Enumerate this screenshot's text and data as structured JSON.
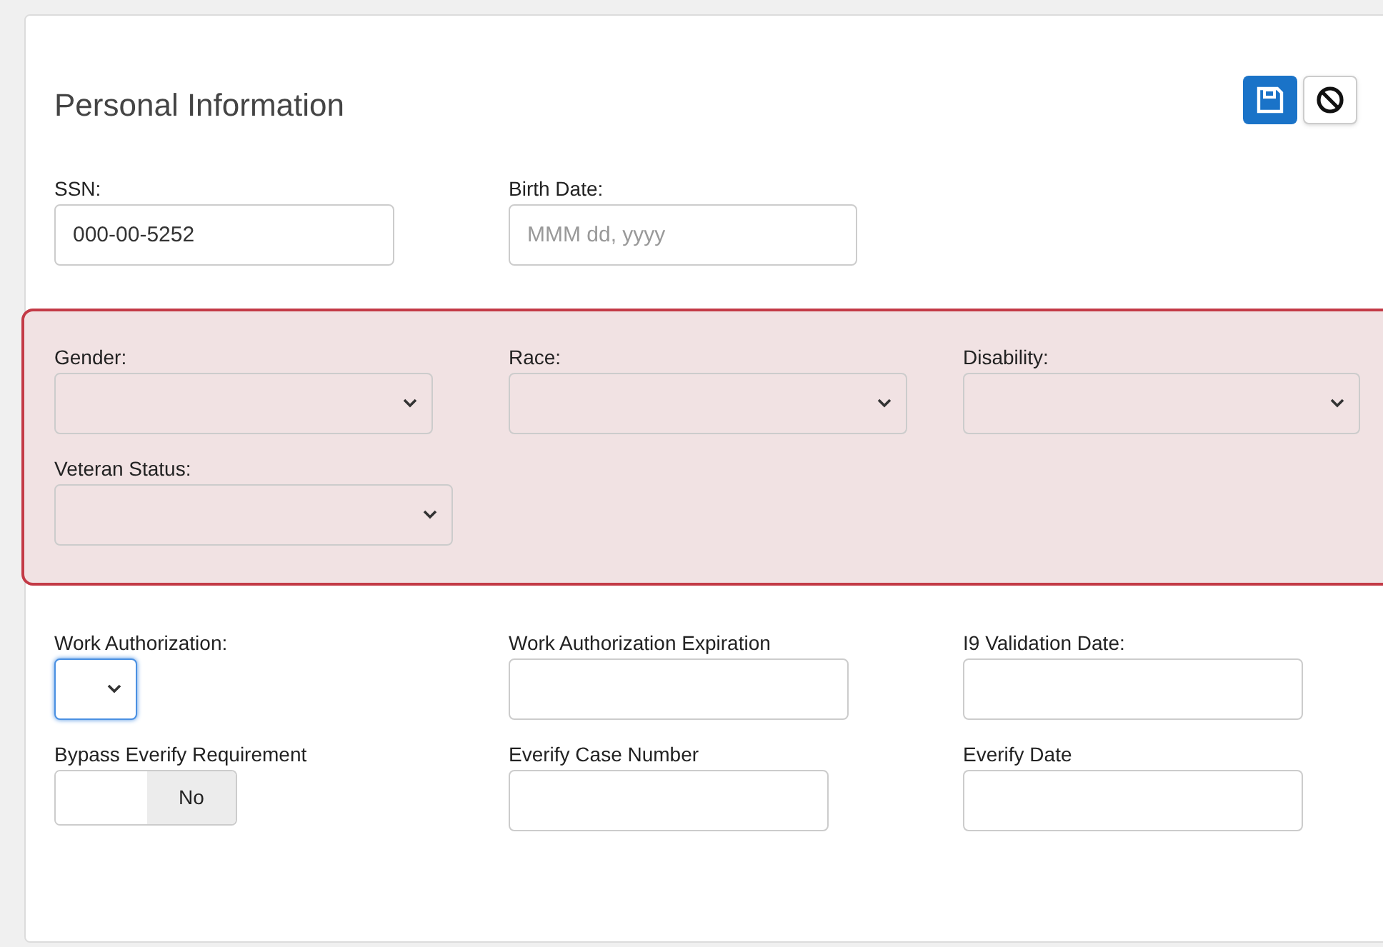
{
  "title": "Personal Information",
  "actions": [
    {
      "kind": "save",
      "primary": true
    },
    {
      "kind": "cancel",
      "primary": false
    }
  ],
  "sections": [
    {
      "highlighted": false,
      "fields": [
        {
          "kind": "text",
          "label": "SSN:",
          "value": "000-00-5252"
        },
        {
          "kind": "text",
          "label": "Birth Date:",
          "placeholder": "MMM dd, yyyy"
        }
      ]
    },
    {
      "highlighted": true,
      "fields": [
        {
          "kind": "select",
          "label": "Gender:",
          "focused": false
        },
        {
          "kind": "select",
          "label": "Race:",
          "focused": false
        },
        {
          "kind": "select",
          "label": "Disability:",
          "focused": false
        },
        {
          "kind": "select",
          "label": "Veteran Status:",
          "focused": false
        }
      ]
    },
    {
      "highlighted": false,
      "fields": [
        {
          "kind": "select",
          "label": "Work Authorization:",
          "focused": true
        },
        {
          "kind": "text",
          "label": "Work Authorization Expiration"
        },
        {
          "kind": "text",
          "label": "I9 Validation Date:"
        },
        {
          "kind": "toggle",
          "label": "Bypass Everify Requirement",
          "value": "No",
          "on": false
        },
        {
          "kind": "text",
          "label": "Everify Case Number"
        },
        {
          "kind": "text",
          "label": "Everify Date"
        }
      ]
    }
  ]
}
